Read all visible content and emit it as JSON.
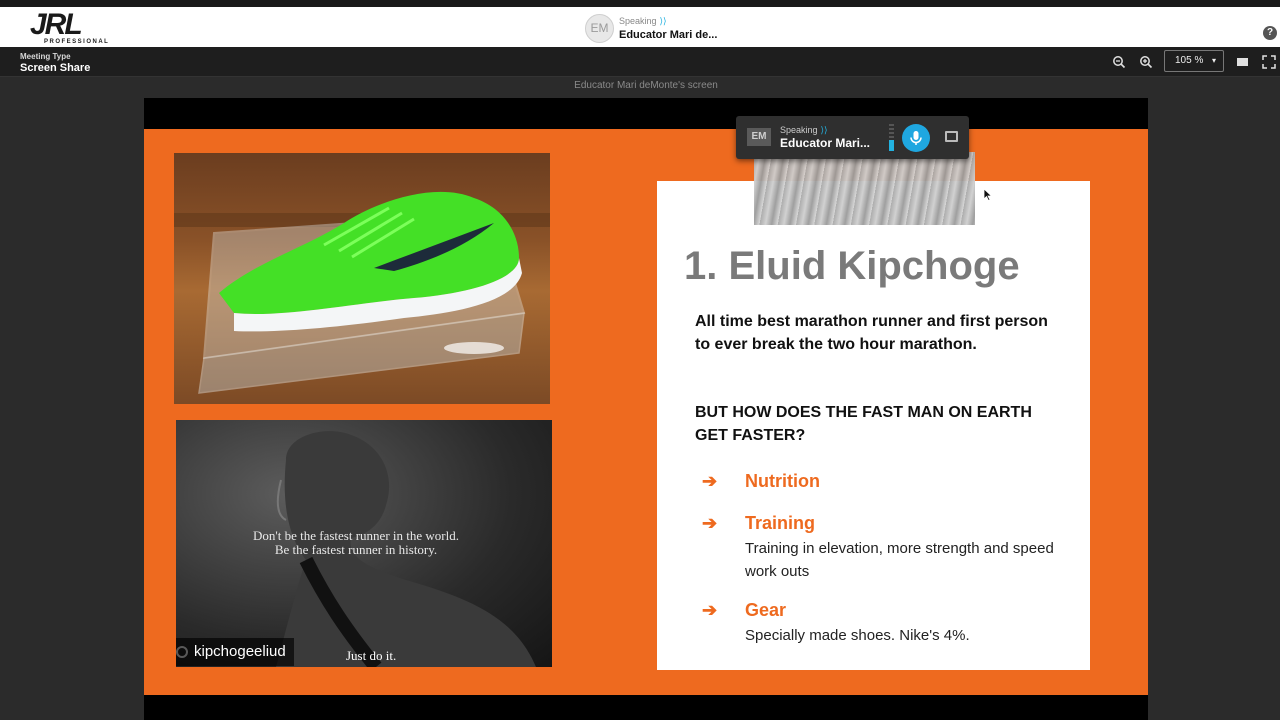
{
  "app": {
    "logo_text": "JRL",
    "logo_sub": "PROFESSIONAL",
    "help_label": "?"
  },
  "top_speaker": {
    "avatar": "EM",
    "status": "Speaking",
    "name": "Educator Mari de..."
  },
  "toolbar": {
    "meeting_type_label": "Meeting Type",
    "meeting_type_value": "Screen Share",
    "zoom_out_icon": "zoom-out-icon",
    "zoom_in_icon": "zoom-in-icon",
    "zoom_value": "105 %",
    "view_icon": "screen-layout-icon",
    "fullscreen_icon": "fullscreen-icon"
  },
  "screen_caption": "Educator Mari deMonte's screen",
  "float_bar": {
    "avatar": "EM",
    "status": "Speaking",
    "name": "Educator Mari...",
    "mic_level": 0.4
  },
  "slide": {
    "title": "1. Eluid Kipchoge",
    "paragraph_1": "All time best marathon runner and first person to ever break the two hour marathon.",
    "paragraph_2": "BUT HOW DOES THE FAST MAN ON EARTH GET FASTER?",
    "bullets": [
      {
        "arrow": "➔",
        "heading": "Nutrition",
        "desc": ""
      },
      {
        "arrow": "➔",
        "heading": "Training",
        "desc": "Training in elevation, more strength and speed work outs"
      },
      {
        "arrow": "➔",
        "heading": "Gear",
        "desc": "Specially made shoes. Nike's 4%."
      }
    ],
    "athlete_quote_1": "Don't be the fastest runner in the world.",
    "athlete_quote_2": "Be the fastest runner in history.",
    "athlete_handle": "kipchogeeliud",
    "athlete_tagline": "Just do it.",
    "colors": {
      "slide_bg": "#ee6a1f",
      "accent": "#ee6a1f",
      "title": "#7a7a7a"
    }
  }
}
